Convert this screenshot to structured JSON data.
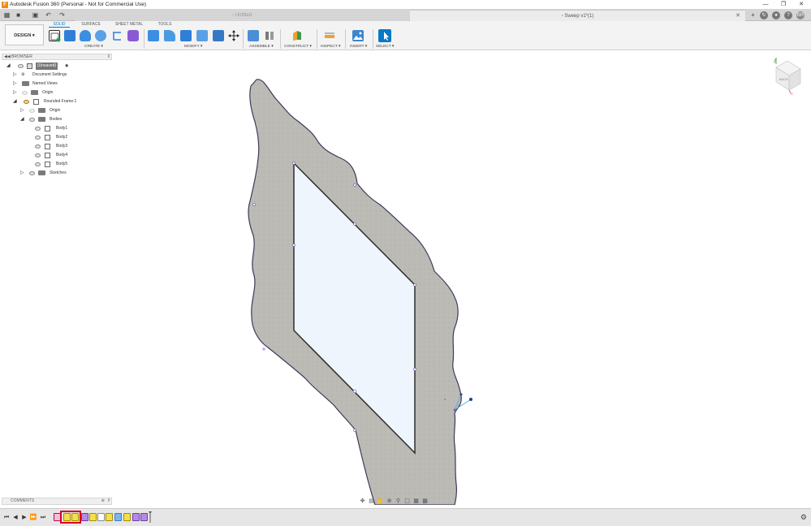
{
  "window": {
    "title": "Autodesk Fusion 360 (Personal - Not for Commercial Use)",
    "logo": "F",
    "controls": [
      "—",
      "❐",
      "✕"
    ]
  },
  "tabs": [
    {
      "label": "Untitled",
      "icon": "document-icon",
      "active": false
    },
    {
      "label": "Sweep v1*(1)",
      "icon": "document-icon",
      "active": true
    }
  ],
  "user": {
    "initials": "BR"
  },
  "toolbar": {
    "workspace_button": "DESIGN ▾",
    "workspace_tabs": [
      "SOLID",
      "SURFACE",
      "SHEET METAL",
      "TOOLS"
    ],
    "groups": [
      "CREATE ▾",
      "MODIFY ▾",
      "ASSEMBLE ▾",
      "CONSTRUCT ▾",
      "INSPECT ▾",
      "INSERT ▾",
      "SELECT ▾"
    ]
  },
  "browser": {
    "title": "BROWSER",
    "items": [
      {
        "label": "(Unsaved)",
        "level": 0
      },
      {
        "label": "Document Settings",
        "level": 1
      },
      {
        "label": "Named Views",
        "level": 1
      },
      {
        "label": "Origin",
        "level": 1
      },
      {
        "label": "Rounded Frame:1",
        "level": 1
      },
      {
        "label": "Origin",
        "level": 2
      },
      {
        "label": "Bodies",
        "level": 2
      },
      {
        "label": "Body1",
        "level": 3
      },
      {
        "label": "Body2",
        "level": 3
      },
      {
        "label": "Body3",
        "level": 3
      },
      {
        "label": "Body4",
        "level": 3
      },
      {
        "label": "Body5",
        "level": 3
      },
      {
        "label": "Sketches",
        "level": 2
      }
    ]
  },
  "comments": {
    "title": "COMMENTS"
  },
  "viewcube": {
    "face": "BACK"
  },
  "colors": {
    "accent": "#0a78c8",
    "frame_fill": "#b8b6b0",
    "opening_fill": "#eef5fc",
    "timeline_highlight": "#d8001c"
  }
}
